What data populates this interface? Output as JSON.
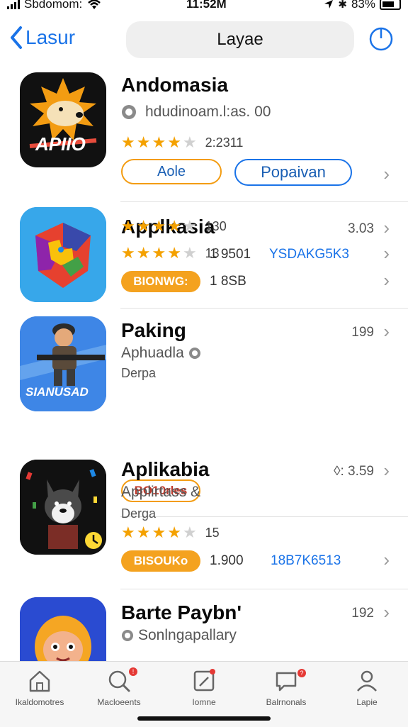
{
  "status": {
    "carrier": "Sbdomom:",
    "time": "11:52M",
    "battery": "83%"
  },
  "nav": {
    "back_label": "Lasur",
    "title": "Layae"
  },
  "apps": [
    {
      "title": "Andomasia",
      "subtitle": "hdudinoam.l:as. 00",
      "rating_count": "2:2311",
      "btn1": "Aole",
      "btn2": "Popaivan",
      "stars": 4
    },
    {
      "title": "Applkasia",
      "price": "3.03",
      "rating_count": "13",
      "badge": "BIONWG:",
      "meta": "1 8SB",
      "stars": 4
    },
    {
      "title": "Paking",
      "price": "199",
      "subtitle": "Aphuadla",
      "subtitle2": "Derpa",
      "rating_count": "130",
      "badge": "BO10rles",
      "meta": "1 9501",
      "code": "YSDAKG5K3",
      "stars": 4
    },
    {
      "title": "Aplikabia",
      "price": "◊: 3.59",
      "subtitle": "Applirtass &",
      "subtitle2": "Derga",
      "rating_count": "15",
      "badge": "BISOUKo",
      "meta": "1.900",
      "code": "18B7K6513",
      "stars": 4
    },
    {
      "title": "Barte Paybn'",
      "price": "192",
      "subtitle": "Sonlngapallary"
    }
  ],
  "tabs": [
    {
      "label": "Ikaldomotres",
      "icon": "home-icon"
    },
    {
      "label": "Macloeents",
      "icon": "search-icon"
    },
    {
      "label": "Iomne",
      "icon": "document-icon"
    },
    {
      "label": "Balrnonals",
      "icon": "chat-icon"
    },
    {
      "label": "Lapie",
      "icon": "person-icon"
    }
  ],
  "colors": {
    "accent": "#1a73e8",
    "star": "#f4a100",
    "badge_orange": "#f4a21f"
  }
}
